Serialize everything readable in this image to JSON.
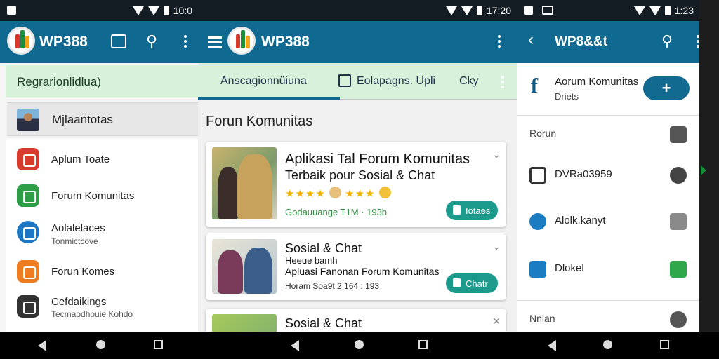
{
  "app": {
    "title": "WP388"
  },
  "screens": {
    "left": {
      "status_time": "10:0",
      "banner": "Regrarionlidlua)",
      "user_name": "Mjlaantotas",
      "menu": [
        {
          "label": "Aplum Toate",
          "sub": ""
        },
        {
          "label": "Forum Komunitas",
          "sub": ""
        },
        {
          "label": "Aolalelaces",
          "sub": "Tonmictcove"
        },
        {
          "label": "Forun Komes",
          "sub": ""
        },
        {
          "label": "Cefdaikings",
          "sub": "Tecmaodhouie Kohdo"
        }
      ]
    },
    "middle": {
      "status_time": "17:20",
      "tabs": [
        "Anscagionnüiuna",
        "Eolapagns. Upli",
        "Cky"
      ],
      "section_title": "Forun Komunitas",
      "cards": [
        {
          "title": "Aplikasi Tal Forum Komunitas",
          "subtitle": "Terbaik pour Sosial & Chat",
          "stars_left": "★★★★",
          "stars_right": "★★★",
          "meta": "Godauuange T1M · 193b",
          "button": "Iotaes"
        },
        {
          "title": "Sosial & Chat",
          "line2": "Heeue bamh",
          "line3": "Apluasi Fanonan Forum Komunitas",
          "meta": "Horam Soa9t 2 164 : 193",
          "button": "Chatr"
        },
        {
          "title": "Sosial & Chat"
        }
      ]
    },
    "right": {
      "status_time": "1:23",
      "header_title": "WP8&&t",
      "forum_title": "Aorum Komunitas",
      "forum_sub": "Driets",
      "rows": [
        {
          "label": "Rorun",
          "color": "#555555"
        },
        {
          "label": "DVRa03959",
          "color": "#444444"
        },
        {
          "label": "Alolk.kanyt",
          "color": "#1b7cc1"
        },
        {
          "label": "Dlokel",
          "color": "#1b7cc1"
        },
        {
          "label": "Nnian",
          "color": "#444444"
        }
      ]
    }
  },
  "colors": {
    "appbar": "#0f6990",
    "accent_green": "#1c9a8c",
    "tab_bg": "#d8f1da"
  },
  "icons": {
    "left_appbar": [
      "edit-icon",
      "search-icon",
      "more-vert-icon"
    ],
    "middle_appbar": [
      "hamburger-menu-icon",
      "more-vert-icon"
    ],
    "right_appbar": [
      "back-arrow-icon",
      "search-icon",
      "more-vert-icon"
    ]
  }
}
